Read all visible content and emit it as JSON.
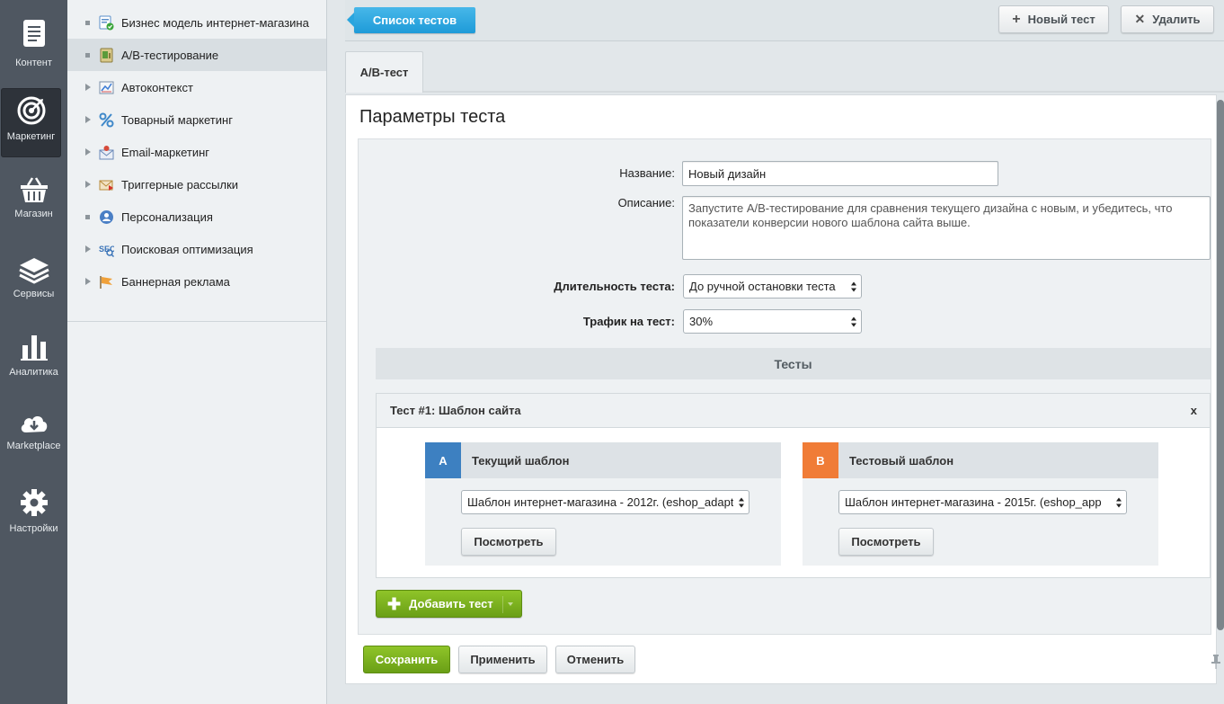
{
  "rail": {
    "items": [
      {
        "label": "Контент",
        "icon": "document-icon"
      },
      {
        "label": "Маркетинг",
        "icon": "target-icon",
        "active": true
      },
      {
        "label": "Магазин",
        "icon": "basket-icon"
      },
      {
        "label": "Сервисы",
        "icon": "layers-icon"
      },
      {
        "label": "Аналитика",
        "icon": "bar-chart-icon"
      },
      {
        "label": "Marketplace",
        "icon": "cloud-download-icon"
      },
      {
        "label": "Настройки",
        "icon": "gear-icon"
      }
    ]
  },
  "submenu": {
    "items": [
      {
        "label": "Бизнес модель интернет-магазина",
        "icon": "business-model-icon",
        "expandable": false
      },
      {
        "label": "A/B-тестирование",
        "icon": "ab-test-icon",
        "expandable": false,
        "active": true
      },
      {
        "label": "Автоконтекст",
        "icon": "autocontext-icon",
        "expandable": true
      },
      {
        "label": "Товарный маркетинг",
        "icon": "percent-icon",
        "expandable": true
      },
      {
        "label": "Email-маркетинг",
        "icon": "email-icon",
        "expandable": true
      },
      {
        "label": "Триггерные рассылки",
        "icon": "trigger-mail-icon",
        "expandable": true
      },
      {
        "label": "Персонализация",
        "icon": "personalization-icon",
        "expandable": false
      },
      {
        "label": "Поисковая оптимизация",
        "icon": "seo-icon",
        "expandable": true
      },
      {
        "label": "Баннерная реклама",
        "icon": "banner-flag-icon",
        "expandable": true
      }
    ]
  },
  "toolbar": {
    "list_label": "Список тестов",
    "new_label": "Новый тест",
    "delete_label": "Удалить"
  },
  "tab": {
    "label": "A/B-тест"
  },
  "form": {
    "title": "Параметры теста",
    "name_label": "Название:",
    "name_value": "Новый дизайн",
    "description_label": "Описание:",
    "description_value": "Запустите A/B-тестирование для сравнения текущего дизайна с новым, и убедитесь, что показатели конверсии нового шаблона сайта выше.",
    "duration_label": "Длительность теста:",
    "duration_value": "До ручной остановки теста",
    "traffic_label": "Трафик на тест:",
    "traffic_value": "30%"
  },
  "tests": {
    "header": "Тесты",
    "test1": {
      "title": "Тест #1: Шаблон сайта",
      "close": "x",
      "variant_a": {
        "letter": "A",
        "color": "#3d80c1",
        "title": "Текущий шаблон",
        "select_value": "Шаблон интернет-магазина - 2012г. (eshop_adapt",
        "view_label": "Посмотреть"
      },
      "variant_b": {
        "letter": "B",
        "color": "#f07c37",
        "title": "Тестовый шаблон",
        "select_value": "Шаблон интернет-магазина - 2015г. (eshop_app",
        "view_label": "Посмотреть"
      }
    },
    "add_label": "Добавить тест"
  },
  "footer": {
    "save_label": "Сохранить",
    "apply_label": "Применить",
    "cancel_label": "Отменить"
  }
}
